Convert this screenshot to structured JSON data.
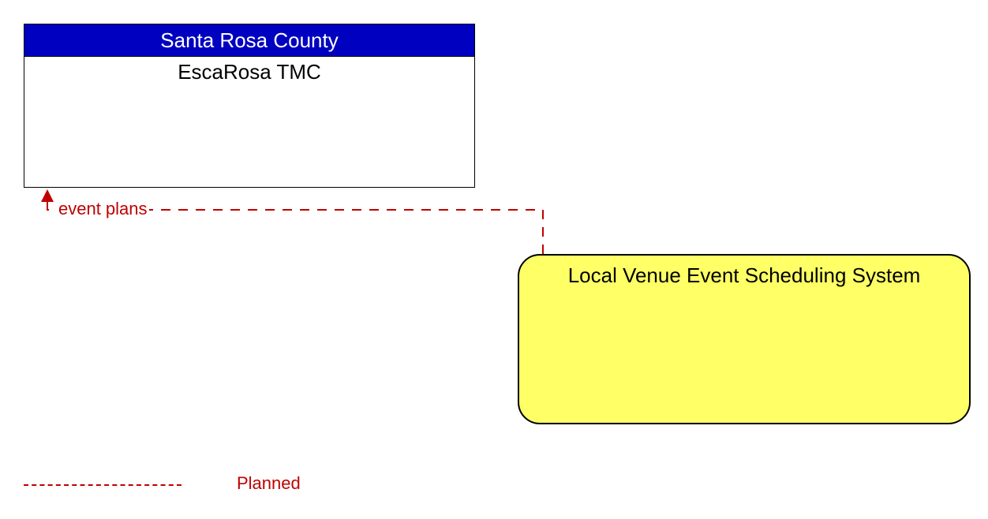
{
  "nodes": {
    "top": {
      "header": "Santa Rosa County",
      "body": "EscaRosa TMC"
    },
    "bottom": {
      "title": "Local Venue Event Scheduling System"
    }
  },
  "flow": {
    "label": "event plans"
  },
  "legend": {
    "planned": "Planned"
  },
  "colors": {
    "header_bg": "#0000c0",
    "header_text": "#ffffff",
    "planned_line": "#c00000",
    "venue_bg": "#ffff66"
  },
  "chart_data": {
    "type": "table",
    "description": "Architecture flow diagram",
    "nodes": [
      {
        "id": "escarosa_tmc",
        "label": "EscaRosa TMC",
        "owner": "Santa Rosa County"
      },
      {
        "id": "local_venue",
        "label": "Local Venue Event Scheduling System"
      }
    ],
    "edges": [
      {
        "from": "local_venue",
        "to": "escarosa_tmc",
        "label": "event plans",
        "status": "Planned"
      }
    ],
    "legend": [
      {
        "style": "dashed",
        "color": "#c00000",
        "meaning": "Planned"
      }
    ]
  }
}
